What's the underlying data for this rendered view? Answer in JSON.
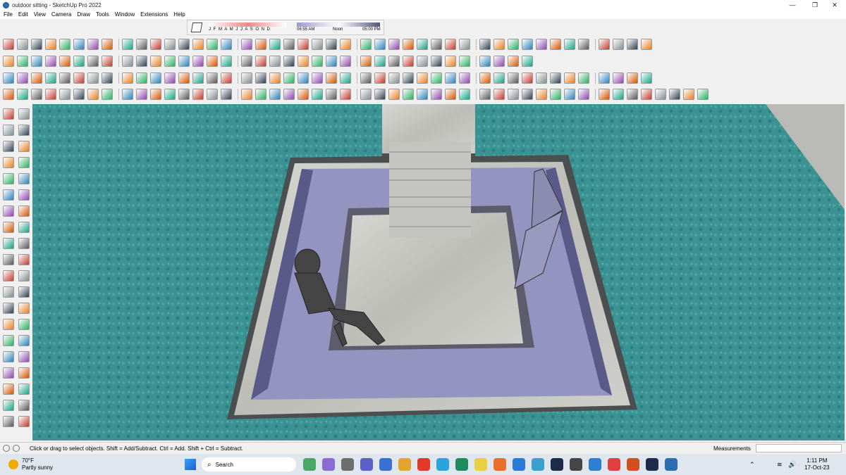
{
  "window": {
    "title": "outdoor sitting - SketchUp Pro 2022",
    "minimize": "—",
    "restore": "❐",
    "close": "✕"
  },
  "menu": [
    "File",
    "Edit",
    "View",
    "Camera",
    "Draw",
    "Tools",
    "Window",
    "Extensions",
    "Help"
  ],
  "shadows": {
    "months": "J F M A M J J A S O N D",
    "time_start": "06:55 AM",
    "time_noon": "Noon",
    "time_end": "05:00 PM"
  },
  "status": {
    "message": "Click or drag to select objects. Shift = Add/Subtract. Ctrl = Add. Shift + Ctrl = Subtract.",
    "measurements_label": "Measurements",
    "measurements_value": ""
  },
  "taskbar": {
    "weather_temp": "70°F",
    "weather_desc": "Partly sunny",
    "search_placeholder": "Search",
    "time": "1:11 PM",
    "date": "17-Oct-23"
  },
  "colors": {
    "water": "#3b9090",
    "marble": "#c8c8c4",
    "pool_floor": "#8f8fb8",
    "accent": "#2b6cb0"
  }
}
